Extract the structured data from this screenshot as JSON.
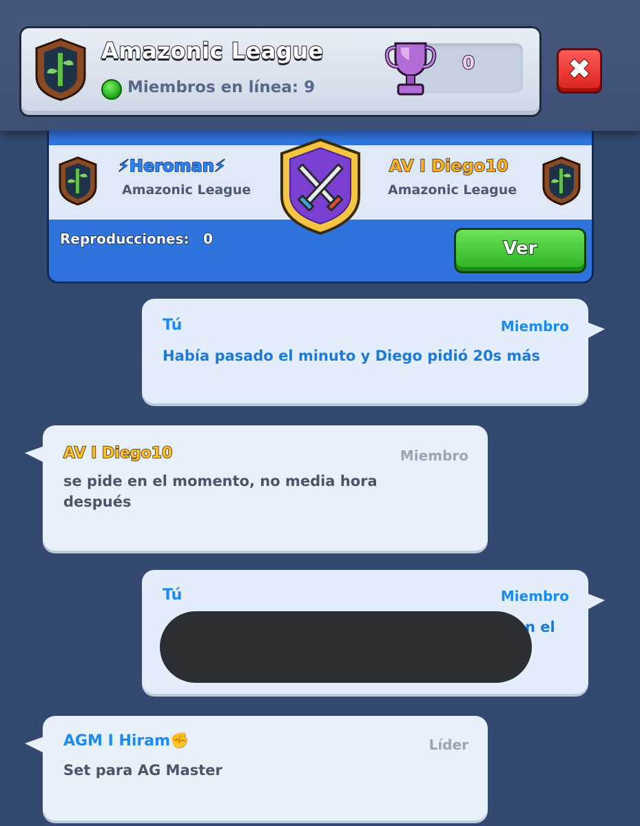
{
  "header": {
    "clan_name": "Amazonic League",
    "online_label": "Miembros en línea: 9",
    "trophies": "0",
    "close_symbol": "✖"
  },
  "battle": {
    "player1": {
      "name": "⚡Heroman⚡",
      "clan": "Amazonic League"
    },
    "player2": {
      "name": "AV I Diego10",
      "clan": "Amazonic League"
    },
    "replays_label": "Reproducciones:",
    "replays_count": "0",
    "view_button": "Ver"
  },
  "messages": [
    {
      "sender": "Tú",
      "role": "Miembro",
      "text": "Había pasado el minuto y Diego pidió 20s más"
    },
    {
      "sender": "AV I Diego10",
      "role": "Miembro",
      "text_line1": "se pide en el momento, no media hora",
      "text_line2": "después"
    },
    {
      "sender": "Tú",
      "role": "Miembro",
      "text_visible": "n el"
    },
    {
      "sender": "AGM I Hiram✊",
      "role": "Líder",
      "text": "Set para AG Master"
    }
  ],
  "colors": {
    "background": "#34496f",
    "battle_blue": "#2f73dd",
    "green_button": "#28b120",
    "close_red": "#d8201c",
    "me_blue": "#1a8bf0"
  }
}
